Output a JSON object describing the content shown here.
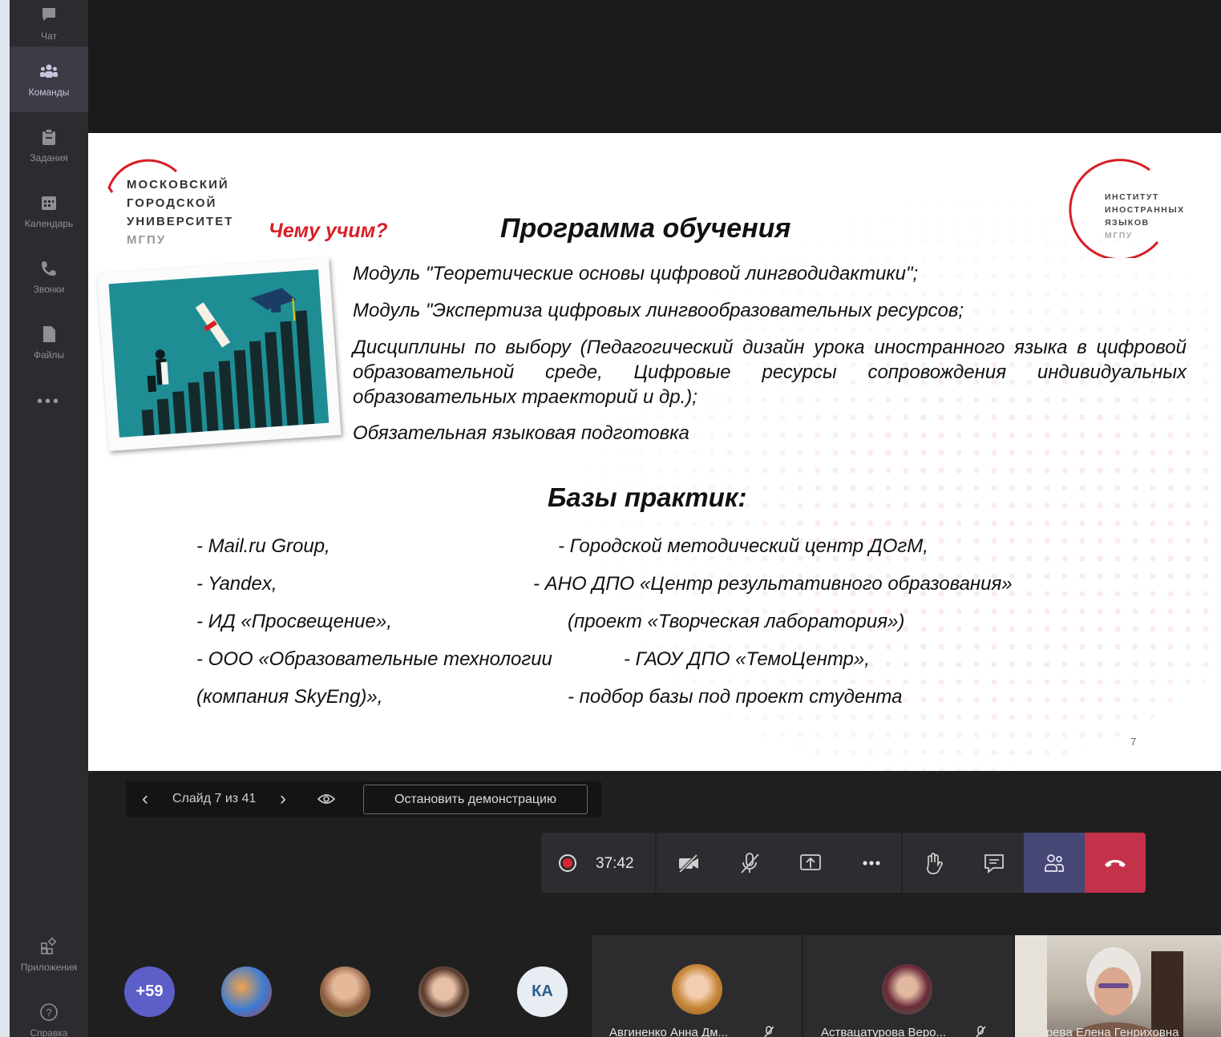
{
  "sidebar": {
    "items": [
      {
        "label": "Чат",
        "icon": "chat-icon"
      },
      {
        "label": "Команды",
        "icon": "teams-icon"
      },
      {
        "label": "Задания",
        "icon": "assignments-icon"
      },
      {
        "label": "Календарь",
        "icon": "calendar-icon"
      },
      {
        "label": "Звонки",
        "icon": "calls-icon"
      },
      {
        "label": "Файлы",
        "icon": "files-icon"
      }
    ],
    "more": "•••",
    "apps_label": "Приложения",
    "help_label": "Справка"
  },
  "slide": {
    "logo_left": [
      "МОСКОВСКИЙ",
      "ГОРОДСКОЙ",
      "УНИВЕРСИТЕТ",
      "МГПУ"
    ],
    "logo_right": [
      "ИНСТИТУТ",
      "ИНОСТРАННЫХ",
      "ЯЗЫКОВ",
      "МГПУ"
    ],
    "what_we_teach": "Чему учим?",
    "program_title": "Программа обучения",
    "modules": [
      "Модуль \"Теоретические основы цифровой лингводидактики\";",
      "Модуль \"Экспертиза цифровых лингвообразовательных ресурсов;",
      "Дисциплины по выбору (Педагогический дизайн урока иностранного языка в цифровой образовательной среде, Цифровые ресурсы сопровождения индивидуальных образовательных траекторий и др.);",
      "Обязательная языковая подготовка"
    ],
    "bases_title": "Базы практик:",
    "bases_left": [
      "- Mail.ru Group,",
      "- Yandex,",
      "- ИД «Просвещение»,",
      "- ООО «Образовательные технологии",
      "(компания SkyEng)»,"
    ],
    "bases_right": [
      "- Городской методический центр ДОгМ,",
      "- АНО ДПО «Центр результативного образования»",
      "(проект «Творческая лаборатория»)",
      "- ГАОУ ДПО «ТемоЦентр»,",
      "- подбор базы под проект студента"
    ],
    "page_number": "7"
  },
  "slide_controls": {
    "counter": "Слайд 7 из 41",
    "stop_label": "Остановить демонстрацию"
  },
  "call": {
    "timer": "37:42",
    "colors": {
      "people": "#464775",
      "hangup": "#c4314b",
      "record": "#d92630"
    }
  },
  "participants": {
    "overflow": "+59",
    "initials": "КА",
    "tiles": [
      {
        "name": "Авгиненко Анна Дм..."
      },
      {
        "name": "Аствацатурова Веро..."
      },
      {
        "name": "Тарева Елена Генриховна"
      }
    ]
  }
}
